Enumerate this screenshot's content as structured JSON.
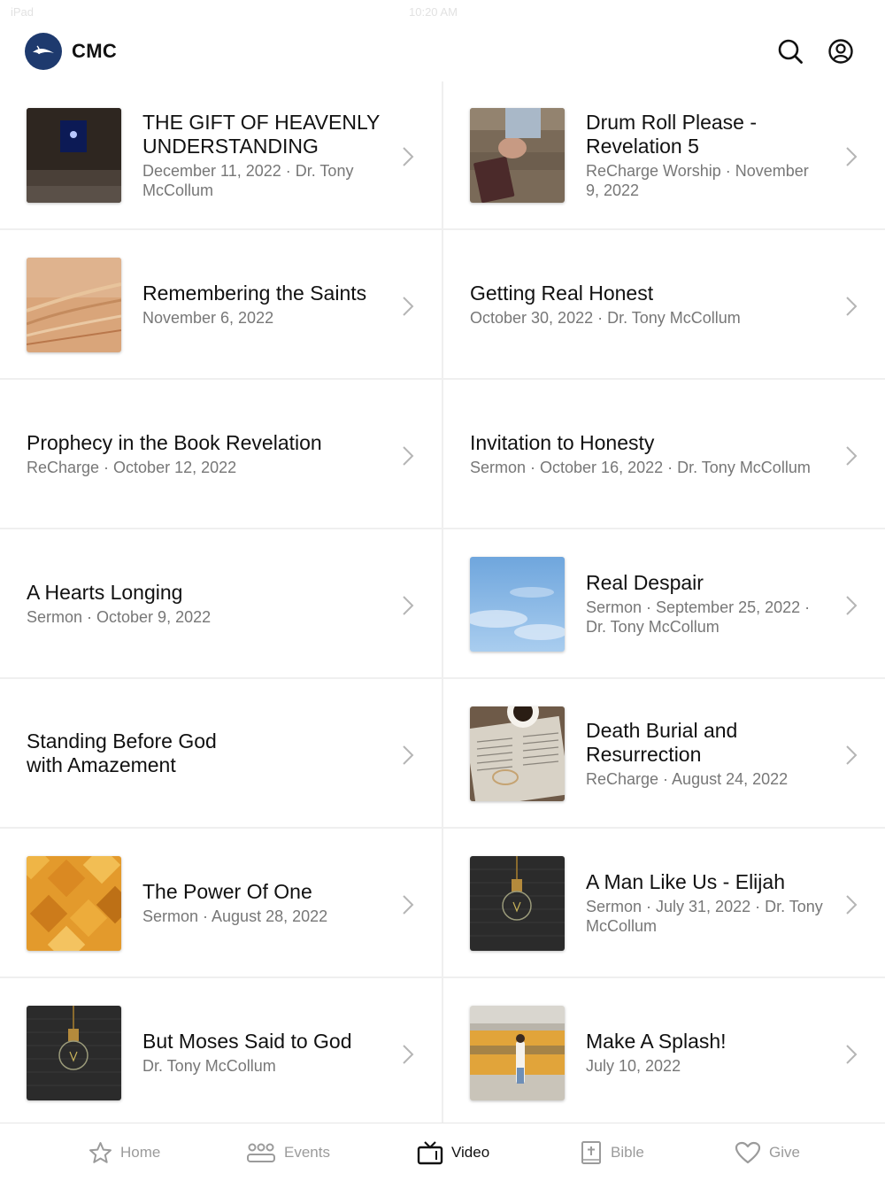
{
  "status_bar": {
    "left": "iPad",
    "time": "10:20 AM"
  },
  "header": {
    "brand": "CMC",
    "logo_icon": "dove-icon",
    "search_icon": "search-icon",
    "account_icon": "account-icon"
  },
  "items": [
    {
      "title": "THE GIFT OF HEAVENLY UNDERSTANDING",
      "meta": "December 11, 2022 · Dr. Tony McCollum",
      "thumb": "dark-window"
    },
    {
      "title": "Drum Roll Please - Revelation 5",
      "meta": "ReCharge Worship · November 9, 2022",
      "thumb": "praying-hands"
    },
    {
      "title": "Remembering the Saints",
      "meta": "November 6, 2022",
      "thumb": "gold-streaks"
    },
    {
      "title": "Getting Real Honest",
      "meta": "October 30, 2022 · Dr. Tony McCollum",
      "thumb": ""
    },
    {
      "title": "Prophecy in the Book Revelation",
      "meta": "ReCharge · October 12, 2022",
      "thumb": ""
    },
    {
      "title": "Invitation to Honesty",
      "meta": "Sermon · October 16, 2022 · Dr. Tony McCollum",
      "thumb": ""
    },
    {
      "title": "A Hearts Longing",
      "meta": "Sermon · October 9, 2022",
      "thumb": ""
    },
    {
      "title": "Real Despair",
      "meta": "Sermon · September 25, 2022 · Dr. Tony McCollum",
      "thumb": "sky"
    },
    {
      "title": "Standing Before God with Amazement",
      "meta": "",
      "thumb": ""
    },
    {
      "title": "Death Burial and Resurrection",
      "meta": "ReCharge · August 24, 2022",
      "thumb": "bible-coffee"
    },
    {
      "title": "The Power Of One",
      "meta": "Sermon · August 28, 2022",
      "thumb": "orange-mosaic"
    },
    {
      "title": "A Man Like Us - Elijah",
      "meta": "Sermon · July 31, 2022 · Dr. Tony McCollum",
      "thumb": "lightbulb"
    },
    {
      "title": "But Moses Said to God",
      "meta": "Dr. Tony McCollum",
      "thumb": "lightbulb"
    },
    {
      "title": "Make A Splash!",
      "meta": "July 10, 2022",
      "thumb": "subway"
    }
  ],
  "tabs": [
    {
      "label": "Home",
      "icon": "star-icon",
      "active": false
    },
    {
      "label": "Events",
      "icon": "people-icon",
      "active": false
    },
    {
      "label": "Video",
      "icon": "tv-icon",
      "active": true
    },
    {
      "label": "Bible",
      "icon": "bible-icon",
      "active": false
    },
    {
      "label": "Give",
      "icon": "heart-icon",
      "active": false
    }
  ],
  "colors": {
    "brand": "#1e3a6e",
    "divider": "#efefef",
    "meta_text": "#777777",
    "tab_inactive": "#9b9b9b"
  }
}
